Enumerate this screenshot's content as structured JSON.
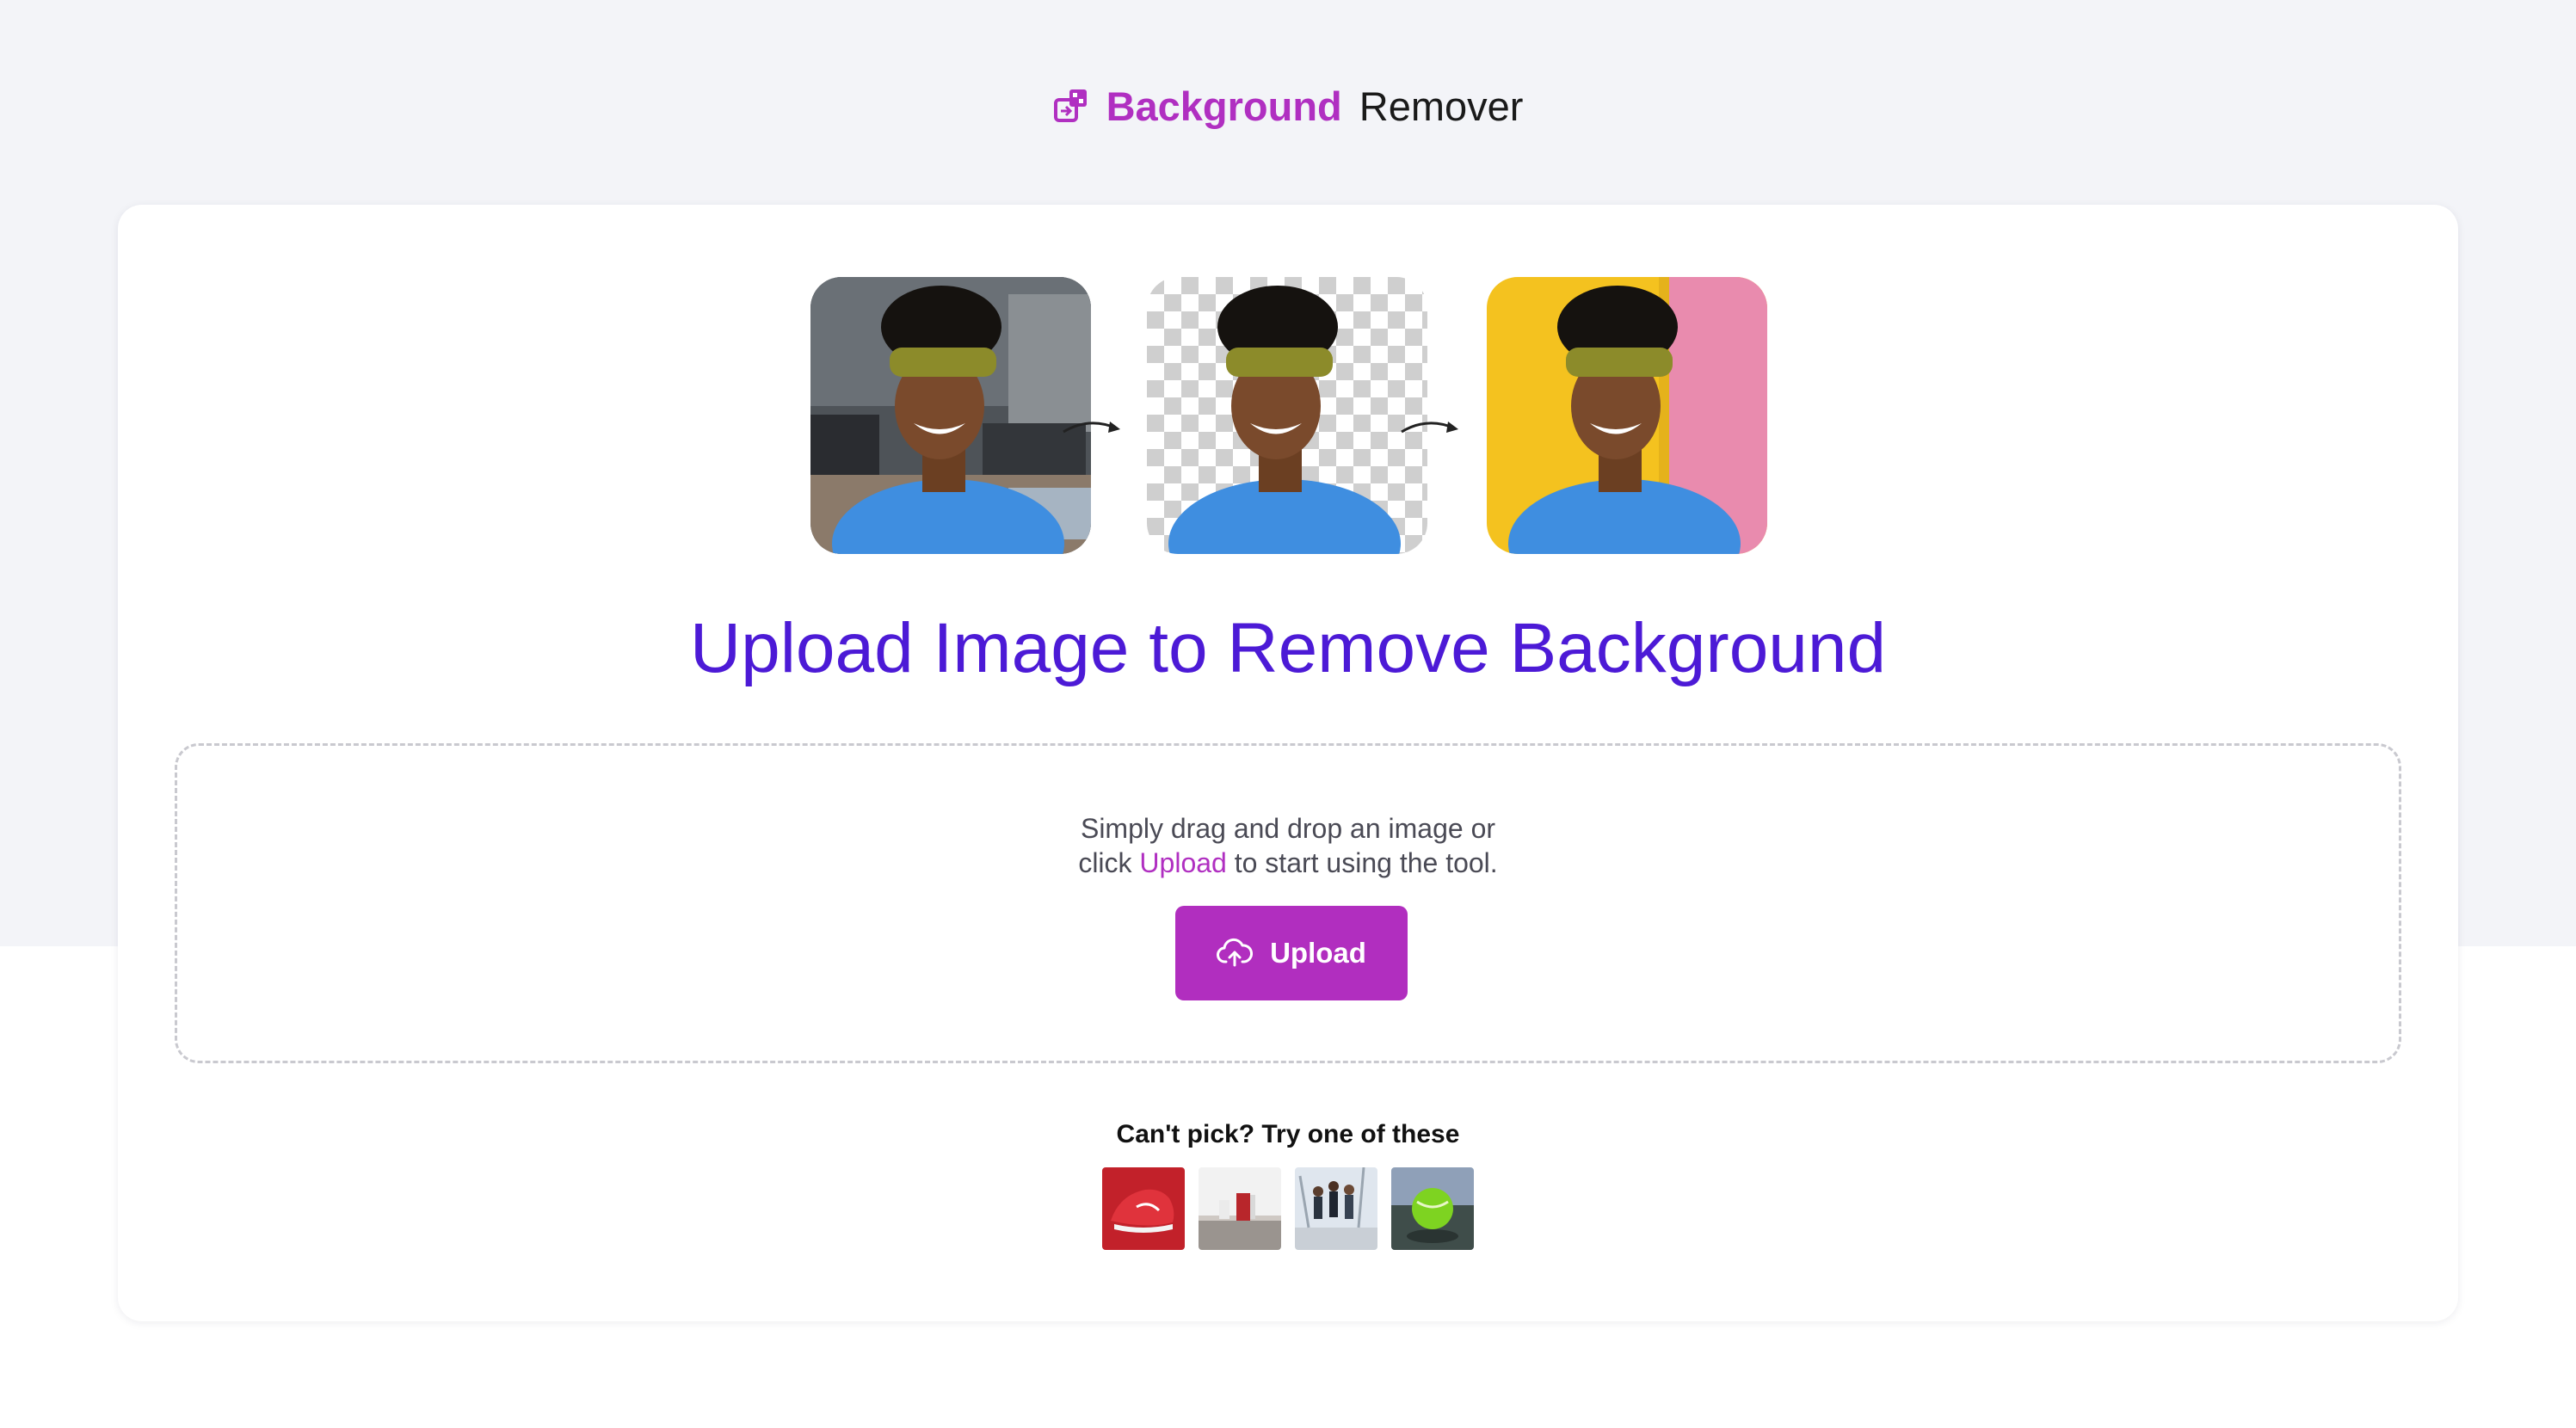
{
  "header": {
    "brand_bold": "Background",
    "brand_light": "Remover",
    "icon": "logo-cube-icon"
  },
  "hero": {
    "steps": [
      {
        "name": "original-photo"
      },
      {
        "name": "cutout-photo"
      },
      {
        "name": "new-background-photo"
      }
    ],
    "arrow_icon": "curved-arrow-icon",
    "headline": "Upload Image to Remove Background"
  },
  "dropzone": {
    "hint_line1": "Simply drag and drop an image or",
    "hint_prefix": "click ",
    "hint_link": "Upload",
    "hint_suffix": " to start using the tool.",
    "button_label": "Upload",
    "button_icon": "cloud-upload-icon"
  },
  "samples": {
    "title": "Can't pick? Try one of these",
    "items": [
      {
        "name": "sample-red-shoe"
      },
      {
        "name": "sample-red-bag"
      },
      {
        "name": "sample-jumping-people"
      },
      {
        "name": "sample-green-ball"
      }
    ]
  },
  "colors": {
    "brand": "#b02fc1",
    "headline": "#4c1ad6",
    "page_band": "#f3f4f8"
  }
}
